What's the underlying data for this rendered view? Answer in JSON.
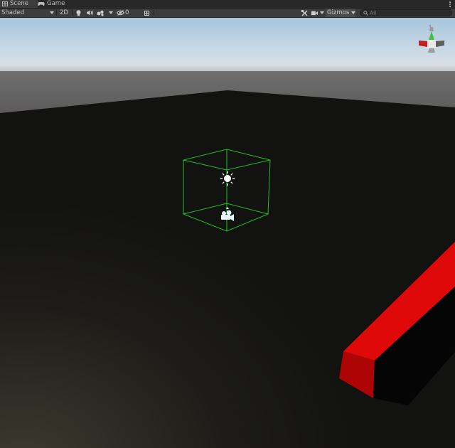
{
  "tabs": [
    {
      "label": "Scene",
      "icon": "scene-grid-icon",
      "active": true
    },
    {
      "label": "Game",
      "icon": "gamepad-icon",
      "active": false
    }
  ],
  "toolbar": {
    "draw_mode": "Shaded",
    "mode_2d": "2D",
    "hidden_count": "0",
    "gizmos_label": "Gizmos",
    "search_placeholder": "All",
    "icons": [
      "lightbulb-icon",
      "audio-icon",
      "effects-icon",
      "hidden-objects-icon",
      "grid-icon",
      "tools-icon",
      "camera-icon",
      "search-icon"
    ]
  },
  "scene": {
    "gizmos": [
      "directional-light-icon",
      "camera-gizmo-icon",
      "scene-orientation-gizmo"
    ],
    "colors": {
      "sky_top": "#a9c6de",
      "horizon": "#6d6b6c",
      "ground": "#161613",
      "bounds_box": "#1fc01f",
      "red_bar": "#e00909",
      "axis_x": "#c41e1e",
      "axis_y": "#3fc23f",
      "axis_z": "#5e5e5e"
    }
  }
}
